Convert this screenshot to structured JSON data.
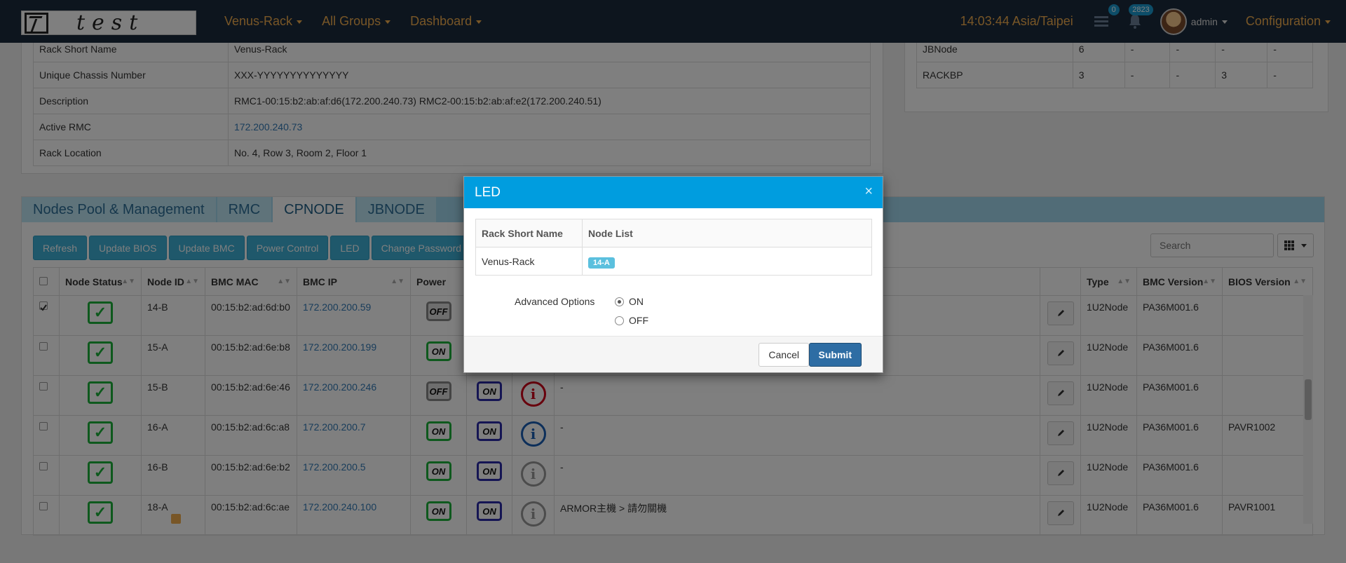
{
  "navbar": {
    "logo_text": "test",
    "menus": [
      "Venus-Rack",
      "All Groups",
      "Dashboard"
    ],
    "clock": "14:03:44 Asia/Taipei",
    "tasks_badge": "0",
    "alerts_badge": "2823",
    "user": "admin",
    "config": "Configuration"
  },
  "rack_info": [
    {
      "label": "Rack Short Name",
      "value": "Venus-Rack"
    },
    {
      "label": "Unique Chassis Number",
      "value": "XXX-YYYYYYYYYYYYYY"
    },
    {
      "label": "Description",
      "value": "RMC1-00:15:b2:ab:af:d6(172.200.240.73) RMC2-00:15:b2:ab:af:e2(172.200.240.51)"
    },
    {
      "label": "Active RMC",
      "value": "172.200.240.73"
    },
    {
      "label": "Rack Location",
      "value": "No. 4, Row 3, Room 2, Floor 1"
    }
  ],
  "summary": [
    {
      "type": "JBNode",
      "c1": "6",
      "c2": "-",
      "c3": "-",
      "c4": "-",
      "c5": "-"
    },
    {
      "type": "RACKBP",
      "c1": "3",
      "c2": "-",
      "c3": "-",
      "c4": "3",
      "c5": "-"
    }
  ],
  "tabs": [
    "Nodes Pool & Management",
    "RMC",
    "CPNODE",
    "JBNODE"
  ],
  "toolbar": [
    "Refresh",
    "Update BIOS",
    "Update BMC",
    "Power Control",
    "LED",
    "Change Password"
  ],
  "search_placeholder": "Search",
  "columns": [
    "Node Status",
    "Node ID",
    "BMC MAC",
    "BMC IP",
    "Power",
    "Type",
    "BMC Version",
    "BIOS Version"
  ],
  "rows": [
    {
      "id": "14-B",
      "mac": "00:15:b2:ad:6d:b0",
      "ip": "172.200.200.59",
      "power": "OFF",
      "led": "",
      "info": "",
      "desc": "",
      "type": "1U2Node",
      "bmc": "PA36M001.6",
      "bios": ""
    },
    {
      "id": "15-A",
      "mac": "00:15:b2:ad:6e:b8",
      "ip": "172.200.200.199",
      "power": "ON",
      "led": "",
      "info": "",
      "desc": "",
      "type": "1U2Node",
      "bmc": "PA36M001.6",
      "bios": ""
    },
    {
      "id": "15-B",
      "mac": "00:15:b2:ad:6e:46",
      "ip": "172.200.200.246",
      "power": "OFF",
      "led": "ON",
      "info": "red",
      "desc": "-",
      "type": "1U2Node",
      "bmc": "PA36M001.6",
      "bios": ""
    },
    {
      "id": "16-A",
      "mac": "00:15:b2:ad:6c:a8",
      "ip": "172.200.200.7",
      "power": "ON",
      "led": "ON",
      "info": "blue",
      "desc": "-",
      "type": "1U2Node",
      "bmc": "PA36M001.6",
      "bios": "PAVR1002"
    },
    {
      "id": "16-B",
      "mac": "00:15:b2:ad:6e:b2",
      "ip": "172.200.200.5",
      "power": "ON",
      "led": "ON",
      "info": "gray",
      "desc": "-",
      "type": "1U2Node",
      "bmc": "PA36M001.6",
      "bios": ""
    },
    {
      "id": "18-A",
      "mac": "00:15:b2:ad:6c:ae",
      "ip": "172.200.240.100",
      "power": "ON",
      "led": "ON",
      "info": "gray",
      "desc": "ARMOR主機 > 請勿關機",
      "type": "1U2Node",
      "bmc": "PA36M001.6",
      "bios": "PAVR1001"
    }
  ],
  "modal": {
    "title": "LED",
    "col1": "Rack Short Name",
    "col2": "Node List",
    "rack": "Venus-Rack",
    "node": "14-A",
    "advanced": "Advanced Options",
    "opt_on": "ON",
    "opt_off": "OFF",
    "cancel": "Cancel",
    "submit": "Submit",
    "close": "×"
  }
}
